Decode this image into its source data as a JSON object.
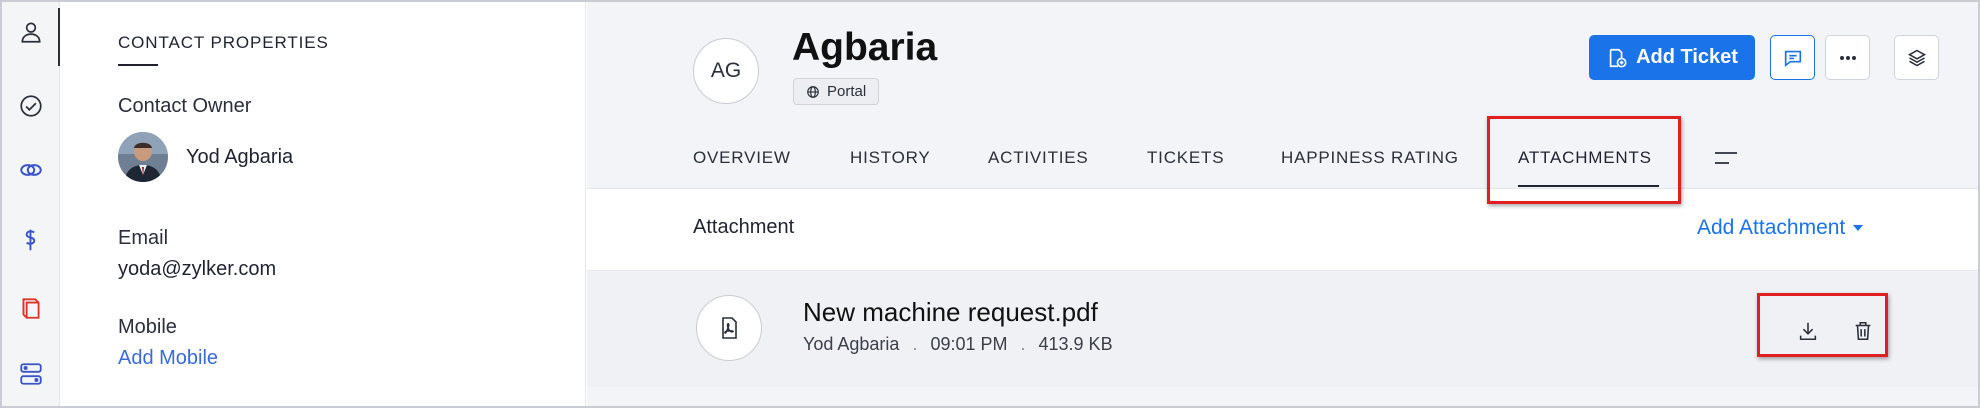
{
  "rail": {
    "items": [
      {
        "icon": "contact-icon",
        "active": true
      },
      {
        "icon": "check-circle-icon"
      },
      {
        "icon": "link-icon"
      },
      {
        "icon": "dollar-hand-icon"
      },
      {
        "icon": "book-icon"
      },
      {
        "icon": "workflow-icon"
      }
    ]
  },
  "properties": {
    "title": "CONTACT PROPERTIES",
    "owner_label": "Contact Owner",
    "owner_name": "Yod Agbaria",
    "email_label": "Email",
    "email_value": "yoda@zylker.com",
    "mobile_label": "Mobile",
    "mobile_value": "Add Mobile"
  },
  "header": {
    "avatar_initials": "AG",
    "name": "Agbaria",
    "badge": "Portal",
    "add_ticket_label": "Add Ticket"
  },
  "tabs": [
    {
      "label": "OVERVIEW"
    },
    {
      "label": "HISTORY"
    },
    {
      "label": "ACTIVITIES"
    },
    {
      "label": "TICKETS"
    },
    {
      "label": "HAPPINESS RATING"
    },
    {
      "label": "ATTACHMENTS",
      "active": true
    }
  ],
  "attachments": {
    "section_title": "Attachment",
    "add_label": "Add Attachment",
    "items": [
      {
        "name": "New machine request.pdf",
        "owner": "Yod Agbaria",
        "time": "09:01 PM",
        "size": "413.9 KB"
      }
    ]
  },
  "colors": {
    "accent": "#1a73e8",
    "highlight": "#e02020"
  }
}
